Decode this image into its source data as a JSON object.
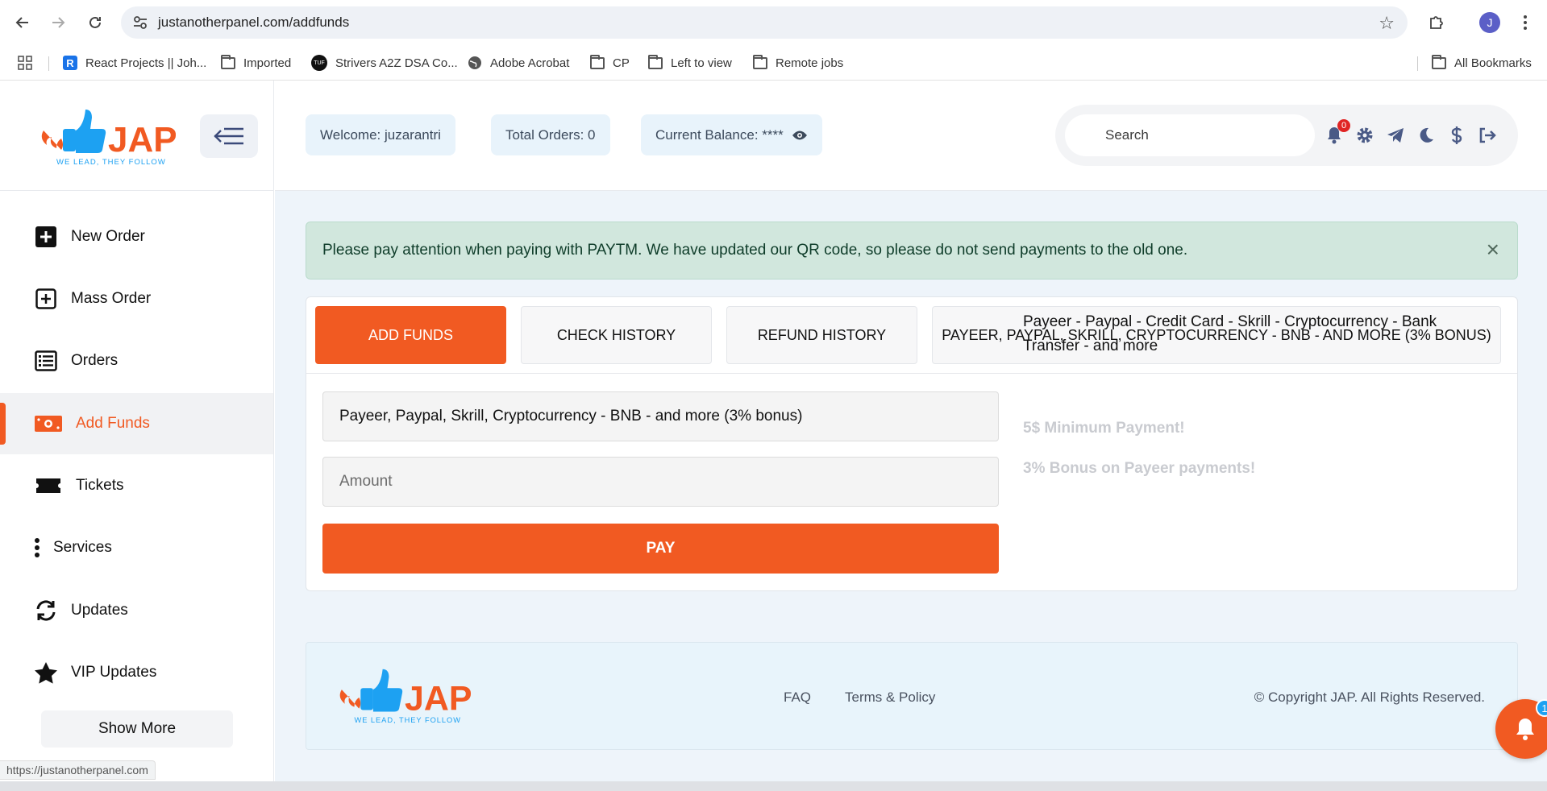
{
  "browser": {
    "url": "justanotherpanel.com/addfunds",
    "status_url": "https://justanotherpanel.com",
    "profile_initial": "J",
    "bookmarks": [
      {
        "label": "React Projects || Joh...",
        "icon": "react-icon"
      },
      {
        "label": "Imported",
        "icon": "folder-icon"
      },
      {
        "label": "Strivers A2Z DSA Co...",
        "icon": "tuf-icon"
      },
      {
        "label": "Adobe Acrobat",
        "icon": "globe-icon"
      },
      {
        "label": "CP",
        "icon": "folder-icon"
      },
      {
        "label": "Left to view",
        "icon": "folder-icon"
      },
      {
        "label": "Remote jobs",
        "icon": "folder-icon"
      }
    ],
    "all_bookmarks": "All Bookmarks",
    "tuf_text": "TUF"
  },
  "brand": {
    "name": "JAP",
    "tagline": "WE LEAD, THEY FOLLOW",
    "accent": "#f15a22",
    "secondary": "#1da1f2"
  },
  "sidebar": {
    "items": [
      {
        "label": "New Order",
        "icon": "plus-square-icon"
      },
      {
        "label": "Mass Order",
        "icon": "plus-box-outline-icon"
      },
      {
        "label": "Orders",
        "icon": "list-icon"
      },
      {
        "label": "Add Funds",
        "icon": "money-icon",
        "active": true
      },
      {
        "label": "Tickets",
        "icon": "ticket-icon"
      },
      {
        "label": "Services",
        "icon": "vertical-dots-icon"
      },
      {
        "label": "Updates",
        "icon": "refresh-icon"
      },
      {
        "label": "VIP Updates",
        "icon": "star-icon"
      }
    ],
    "show_more": "Show More"
  },
  "header": {
    "welcome": "Welcome: juzarantri",
    "total_orders": "Total Orders: 0",
    "balance": "Current Balance: ****",
    "search_placeholder": "Search",
    "notification_count": "0"
  },
  "alert": {
    "text": "Please pay attention when paying with PAYTM. We have updated our QR code, so please do not send payments to the old one.",
    "close": "×"
  },
  "funds": {
    "tabs": [
      {
        "label": "ADD FUNDS",
        "active": true
      },
      {
        "label": "CHECK HISTORY"
      },
      {
        "label": "REFUND HISTORY"
      },
      {
        "label": "PAYEER, PAYPAL, SKRILL, CRYPTOCURRENCY - BNB - AND MORE (3% BONUS)"
      }
    ],
    "method_value": "Payeer, Paypal, Skrill, Cryptocurrency - BNB - and more (3% bonus)",
    "amount_placeholder": "Amount",
    "pay_label": "PAY",
    "description": "Payeer - Paypal - Credit Card - Skrill - Cryptocurrency - Bank Transfer - and more",
    "min_note": "5$ Minimum Payment!",
    "bonus_note": "3% Bonus on Payeer payments!"
  },
  "footer": {
    "faq": "FAQ",
    "terms": "Terms & Policy",
    "copyright": "© Copyright JAP. All Rights Reserved."
  },
  "fab": {
    "count": "1"
  }
}
